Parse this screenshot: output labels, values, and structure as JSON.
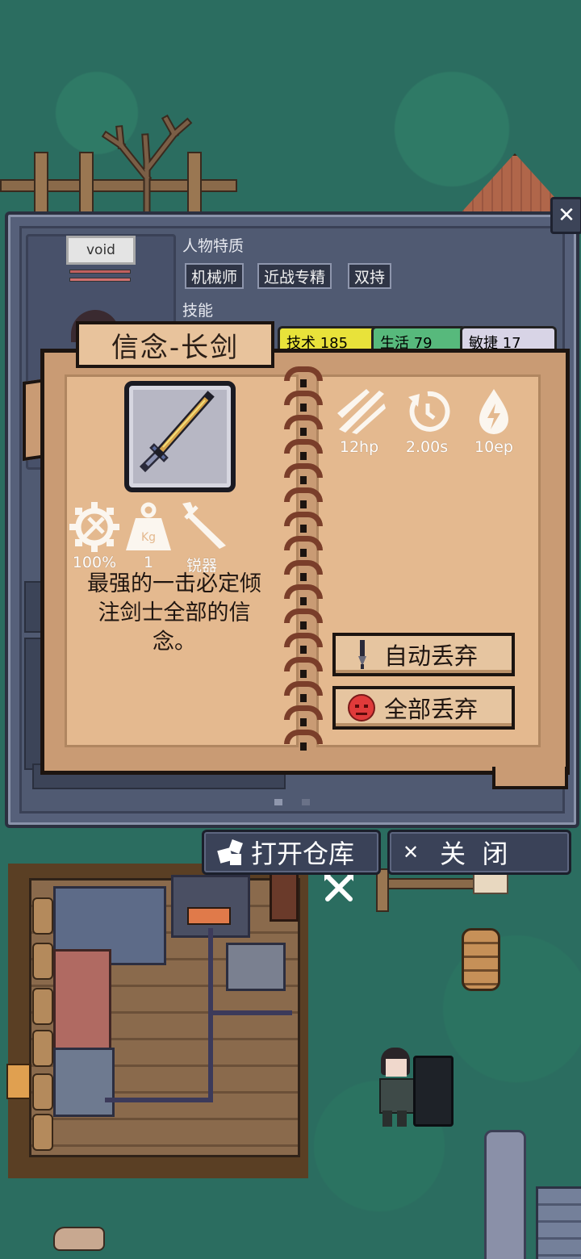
{
  "player": {
    "name": "void"
  },
  "traits": {
    "label": "人物特质",
    "items": [
      "机械师",
      "近战专精",
      "双持"
    ]
  },
  "skills": {
    "label": "技能",
    "tabs": [
      {
        "label": "技术 185",
        "color": "#e8e23a"
      },
      {
        "label": "生活 79",
        "color": "#57b97c"
      },
      {
        "label": "敏捷 17",
        "color": "#d8d4e6"
      }
    ]
  },
  "book": {
    "title": "信念-长剑",
    "item_icon": "longsword-icon",
    "attributes": [
      {
        "icon": "durability-gear-icon",
        "value": "100%"
      },
      {
        "icon": "weight-kg-icon",
        "value": "1"
      },
      {
        "icon": "blade-dagger-icon",
        "value": "锐器"
      }
    ],
    "combat_stats": [
      {
        "icon": "slash-damage-icon",
        "value": "12hp"
      },
      {
        "icon": "cooldown-icon",
        "value": "2.00s"
      },
      {
        "icon": "energy-drop-icon",
        "value": "10ep"
      }
    ],
    "description": "最强的一击必定倾注剑士全部的信念。",
    "buttons": {
      "auto_discard": "自动丢弃",
      "discard_all": "全部丢弃"
    }
  },
  "bottom_bar": {
    "open_storage": "打开仓库",
    "close": "关  闭"
  },
  "colors": {
    "panel": "#56607a",
    "parchment": "#e4b98f",
    "spine_rings": "#7a3e2a",
    "grass": "#2b6d60"
  }
}
